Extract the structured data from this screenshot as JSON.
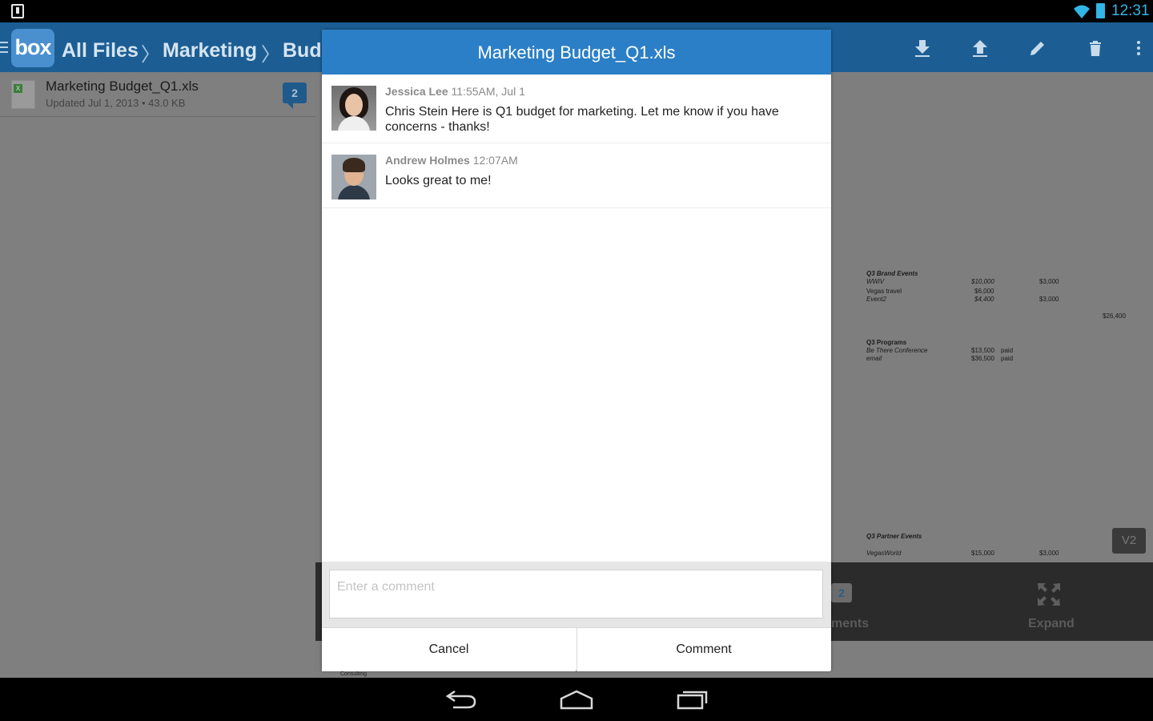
{
  "status_bar": {
    "time": "12:31",
    "icons": [
      "download-notification-icon",
      "wifi-icon",
      "battery-icon"
    ],
    "accent_color": "#33b5e5"
  },
  "app_bar": {
    "logo_text": "box",
    "breadcrumbs": [
      "All Files",
      "Marketing",
      "Budg"
    ],
    "actions": [
      "download-icon",
      "upload-icon",
      "edit-icon",
      "delete-icon",
      "overflow-menu-icon"
    ],
    "color": "#1c5e94"
  },
  "file_list": {
    "items": [
      {
        "name": "Marketing Budget_Q1.xls",
        "meta": "Updated Jul 1, 2013 • 43.0 KB",
        "comment_count": "2",
        "icon": "excel-file-icon"
      }
    ]
  },
  "preview": {
    "sheet": {
      "brand_events_title": "Q3 Brand Events",
      "wwiv": "WWiV",
      "wwiv_amount": "$10,000",
      "wwiv_col2": "$3,000",
      "vegas_travel": "Vegas travel",
      "vegas_travel_amount": "$6,000",
      "event2": "Event2",
      "event2_amount": "$4,400",
      "event2_col2": "$3,000",
      "total": "$26,400",
      "programs_title": "Q3 Programs",
      "be_there": "Be There Conference",
      "be_there_amount": "$13,500",
      "be_there_status": "paid",
      "email": "email",
      "email_amount": "$36,500",
      "email_status": "paid",
      "partner_title": "Q3 Partner Events",
      "vegasworld": "VegasWorld",
      "vegasworld_amount": "$15,000",
      "vegasworld_col2": "$3,000",
      "consulting": "Consulting"
    },
    "version": "V2",
    "bottom_panel": {
      "comments_badge": "2",
      "comments_label": "ments",
      "expand_label": "Expand"
    }
  },
  "dialog": {
    "title": "Marketing Budget_Q1.xls",
    "header_color": "#2b7fc6",
    "comments": [
      {
        "author": "Jessica Lee",
        "time": "11:55AM, Jul 1",
        "text": "Chris Stein Here is Q1 budget for marketing. Let me know if you have concerns - thanks!"
      },
      {
        "author": "Andrew Holmes",
        "time": "12:07AM",
        "text": "Looks great to me!"
      }
    ],
    "input_placeholder": "Enter a comment",
    "cancel_label": "Cancel",
    "comment_label": "Comment"
  },
  "nav_bar": {
    "buttons": [
      "back-icon",
      "home-icon",
      "recents-icon"
    ]
  }
}
